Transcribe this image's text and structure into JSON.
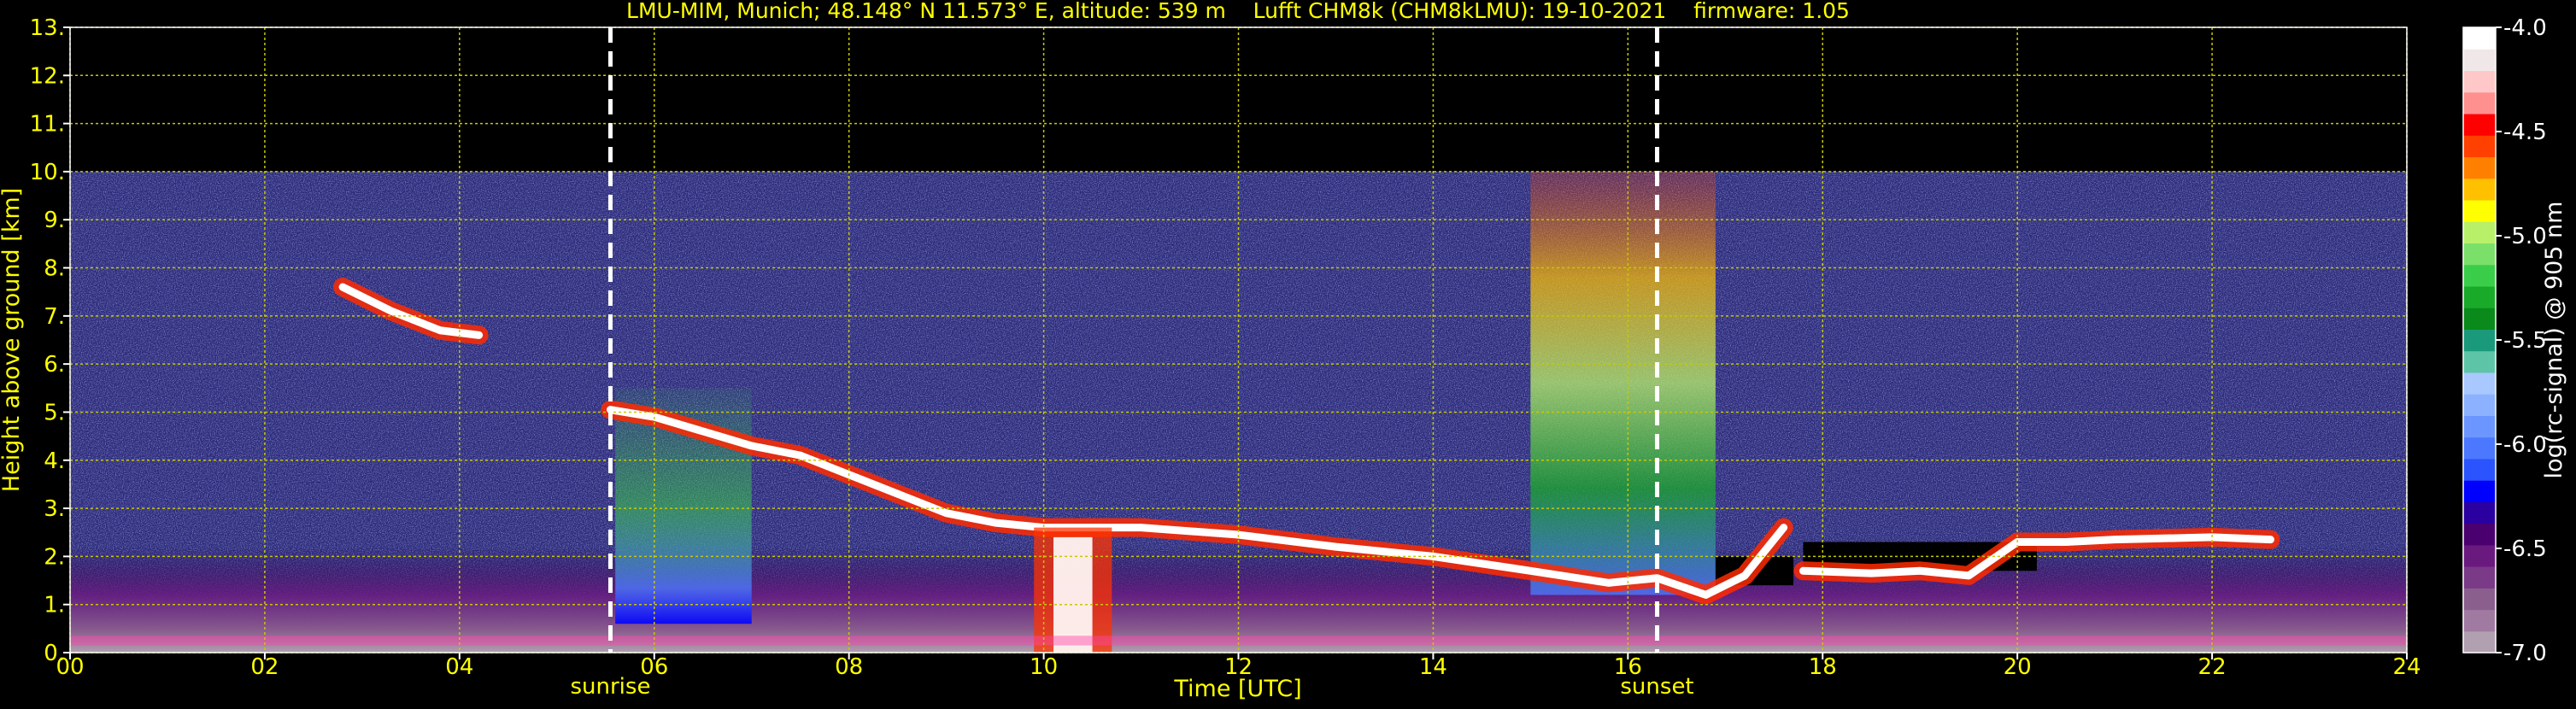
{
  "chart_data": {
    "type": "heatmap",
    "title": "LMU-MIM, Munich; 48.148° N 11.573° E, altitude: 539 m    Lufft CHM8k (CHM8kLMU): 19-10-2021    firmware: 1.05",
    "xlabel": "Time [UTC]",
    "ylabel": "Height above ground [km]",
    "xlim": [
      0,
      24
    ],
    "ylim": [
      0,
      13
    ],
    "x_tick_labels": [
      "00",
      "02",
      "04",
      "06",
      "08",
      "10",
      "12",
      "14",
      "16",
      "18",
      "20",
      "22",
      "24"
    ],
    "y_tick_labels": [
      "0.",
      "1.",
      "2.",
      "3.",
      "4.",
      "5.",
      "6.",
      "7.",
      "8.",
      "9.",
      "10.",
      "11.",
      "12.",
      "13."
    ],
    "grid": true,
    "data_top_km": 10,
    "markers": [
      {
        "label": "sunrise",
        "x": 5.55
      },
      {
        "label": "sunset",
        "x": 16.3
      }
    ],
    "colorbar": {
      "label": "log(rc-signal) @ 905 nm",
      "range": [
        -7.0,
        -4.0
      ],
      "tick_labels": [
        "-7.0",
        "-6.5",
        "-6.0",
        "-5.5",
        "-5.0",
        "-4.5",
        "-4.0"
      ],
      "colors": [
        "#b0a0b0",
        "#a07aa0",
        "#8a5f8e",
        "#7a3a88",
        "#6a1a7f",
        "#4b0070",
        "#2a00a0",
        "#0000ff",
        "#2b54ff",
        "#4b78ff",
        "#6c96ff",
        "#8cb2ff",
        "#a8c8ff",
        "#5ec4a8",
        "#1a9a7a",
        "#0a8a1a",
        "#1aaa2a",
        "#3acd4a",
        "#7ae06a",
        "#b8f06a",
        "#ffff00",
        "#ffc000",
        "#ff8000",
        "#ff4000",
        "#ff0000",
        "#ff9090",
        "#ffc8c8",
        "#f0e8e8",
        "#ffffff"
      ]
    },
    "features": [
      {
        "name": "cloud-layer",
        "points": [
          [
            5.55,
            5.05
          ],
          [
            6.0,
            4.9
          ],
          [
            6.5,
            4.6
          ],
          [
            7.0,
            4.3
          ],
          [
            7.5,
            4.1
          ],
          [
            8.0,
            3.7
          ],
          [
            8.5,
            3.3
          ],
          [
            9.0,
            2.9
          ],
          [
            9.5,
            2.7
          ],
          [
            10.0,
            2.6
          ],
          [
            11.0,
            2.6
          ],
          [
            12.0,
            2.45
          ],
          [
            13.0,
            2.2
          ],
          [
            14.0,
            2.0
          ],
          [
            15.0,
            1.7
          ],
          [
            15.8,
            1.45
          ],
          [
            16.3,
            1.55
          ],
          [
            16.8,
            1.2
          ],
          [
            17.2,
            1.6
          ],
          [
            17.6,
            2.6
          ]
        ]
      },
      {
        "name": "cloud-layer-evening",
        "points": [
          [
            17.8,
            1.7
          ],
          [
            18.5,
            1.65
          ],
          [
            19.0,
            1.7
          ],
          [
            19.5,
            1.6
          ],
          [
            20.0,
            2.3
          ],
          [
            20.5,
            2.3
          ],
          [
            21.0,
            2.35
          ],
          [
            22.0,
            2.4
          ],
          [
            22.6,
            2.35
          ]
        ]
      },
      {
        "name": "cloud-layer-early",
        "points": [
          [
            2.8,
            7.6
          ],
          [
            3.3,
            7.1
          ],
          [
            3.8,
            6.7
          ],
          [
            4.2,
            6.6
          ]
        ]
      }
    ]
  }
}
